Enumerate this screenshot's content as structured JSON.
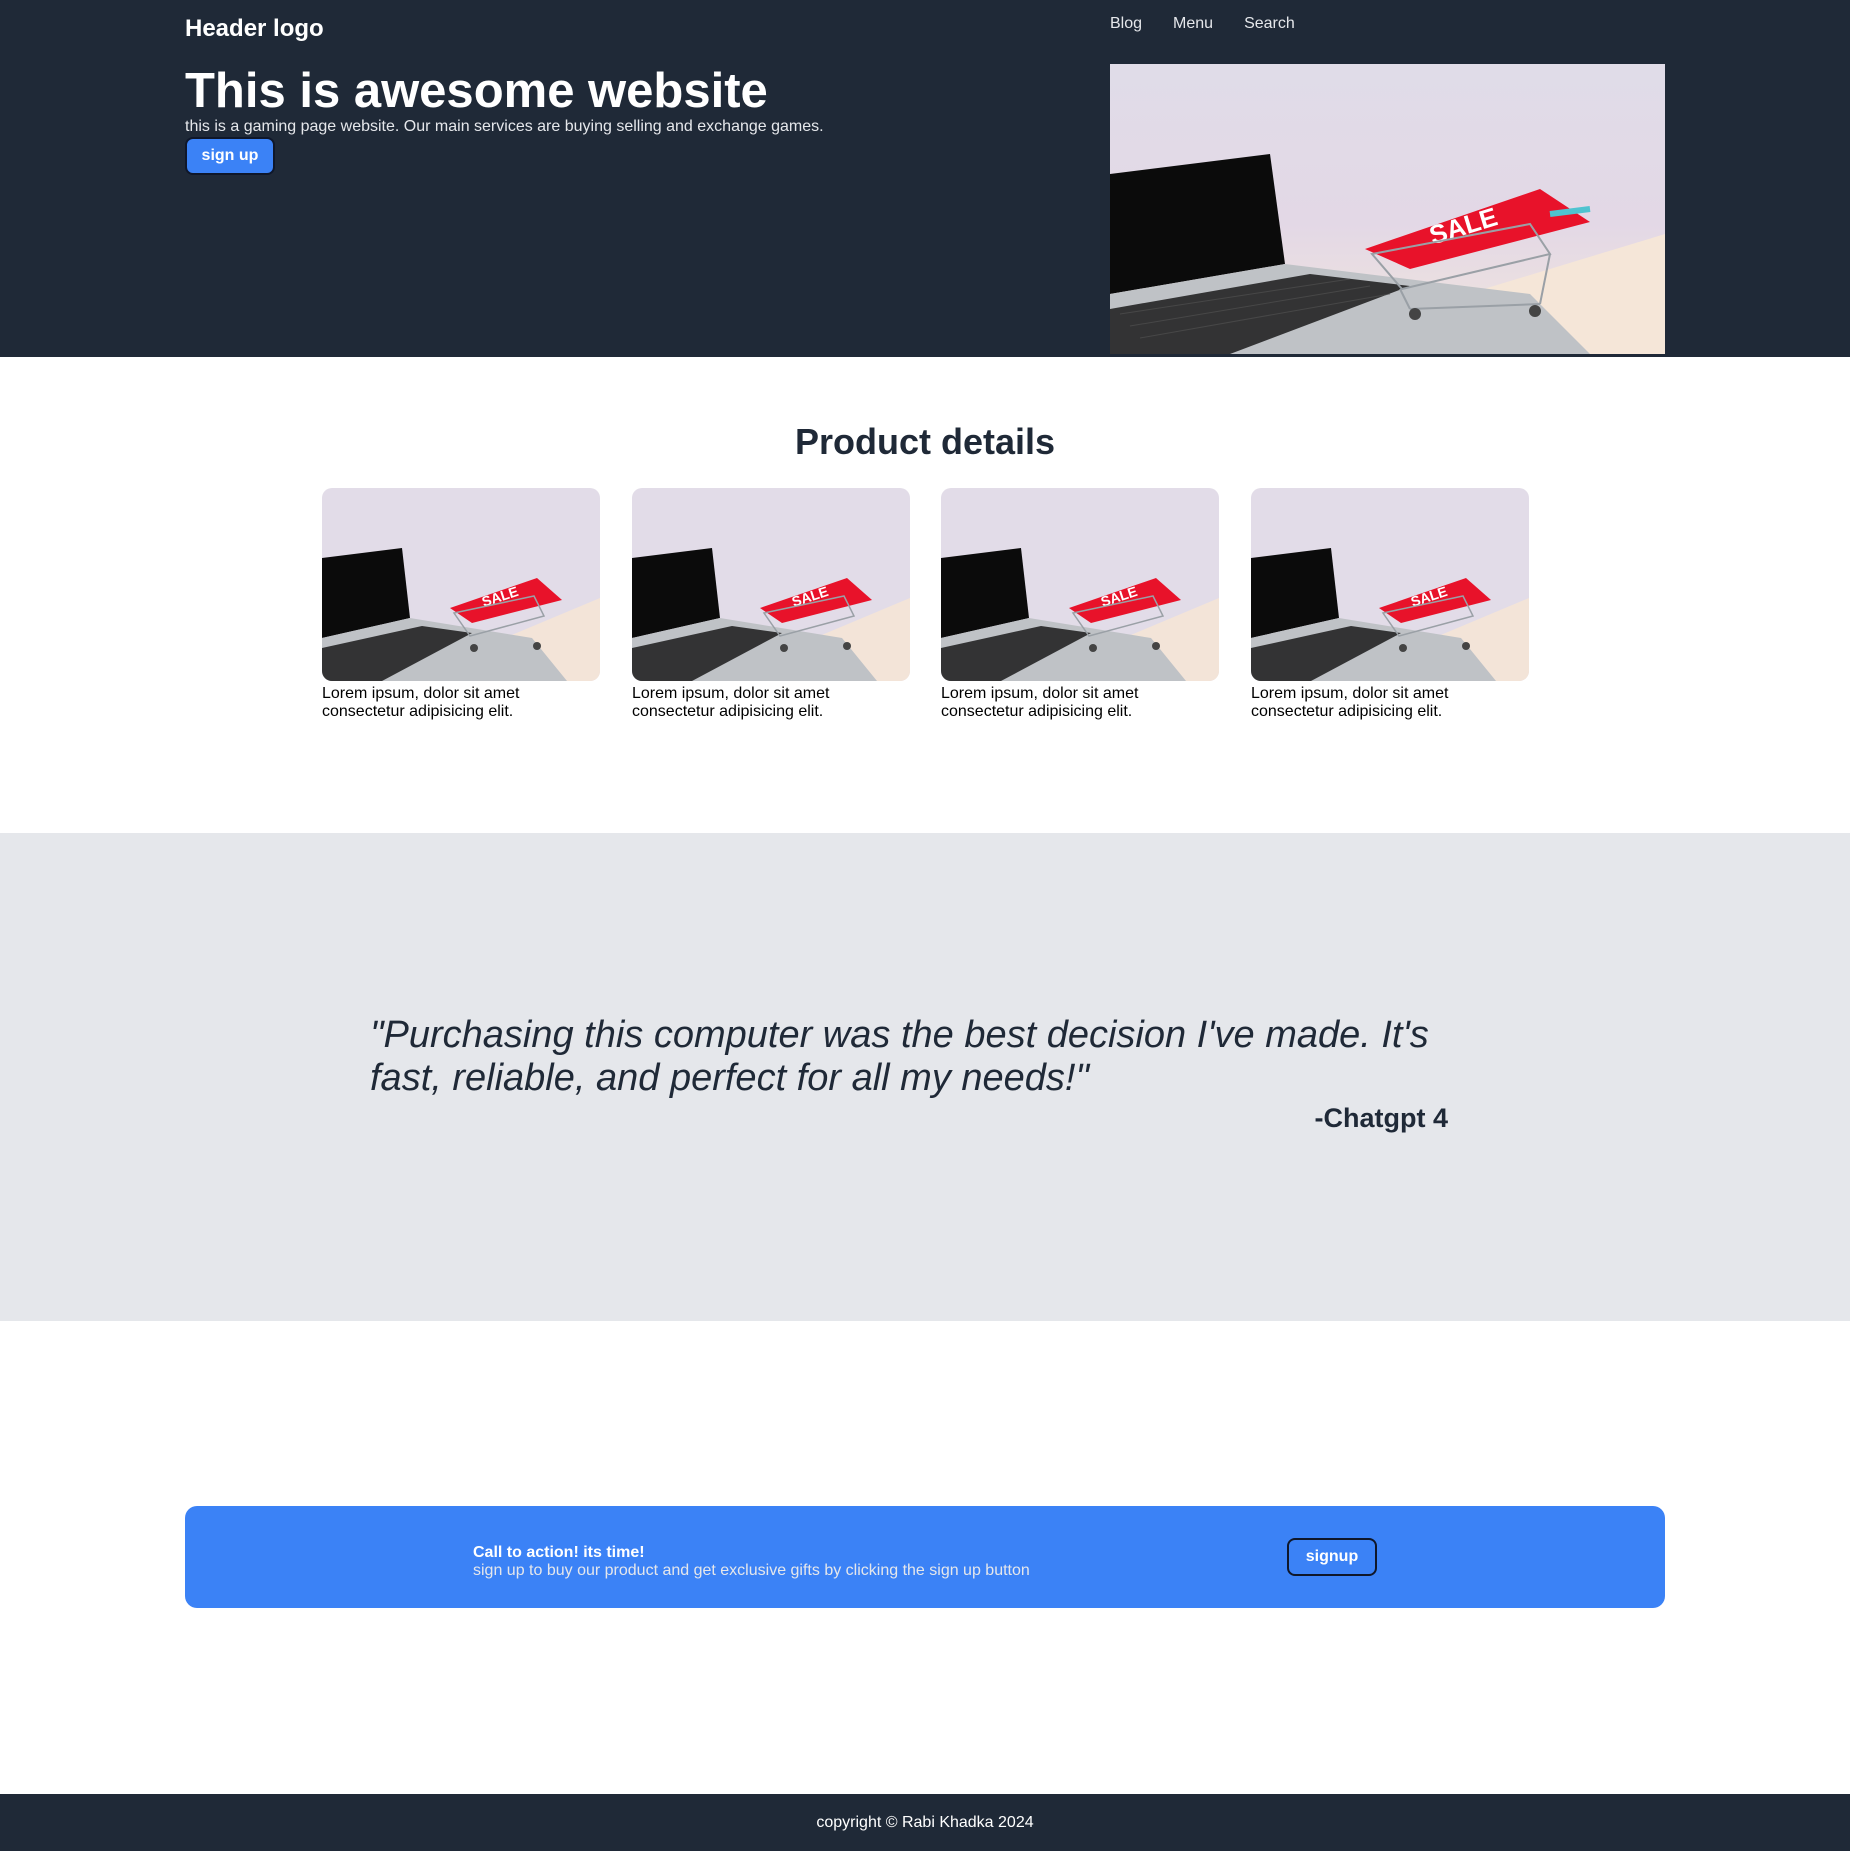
{
  "header": {
    "logo": "Header logo",
    "nav": [
      "Blog",
      "Menu",
      "Search"
    ]
  },
  "hero": {
    "title": "This is awesome website",
    "subtitle": "this is a gaming page website. Our main services are buying selling and exchange games.",
    "button_label": "sign up",
    "image_sale_text": "SALE",
    "image_alt": "laptop with shopping cart and SALE sign"
  },
  "products": {
    "title": "Product details",
    "items": [
      {
        "caption": "Lorem ipsum, dolor sit amet consectetur adipisicing elit.",
        "image_sale_text": "SALE"
      },
      {
        "caption": "Lorem ipsum, dolor sit amet consectetur adipisicing elit.",
        "image_sale_text": "SALE"
      },
      {
        "caption": "Lorem ipsum, dolor sit amet consectetur adipisicing elit.",
        "image_sale_text": "SALE"
      },
      {
        "caption": "Lorem ipsum, dolor sit amet consectetur adipisicing elit.",
        "image_sale_text": "SALE"
      }
    ]
  },
  "testimonial": {
    "quote": "\"Purchasing this computer was the best decision I've made. It's fast, reliable, and perfect for all my needs!\"",
    "author": "-Chatgpt 4"
  },
  "cta": {
    "heading": "Call to action! its time!",
    "text": "sign up to buy our product and get exclusive gifts by clicking the sign up button",
    "button_label": "signup"
  },
  "footer": {
    "text": "copyright © Rabi Khadka 2024"
  },
  "colors": {
    "dark": "#1f2937",
    "accent": "#3b82f6",
    "testimonial_bg": "#e5e7eb",
    "sale_red": "#e8122a"
  }
}
